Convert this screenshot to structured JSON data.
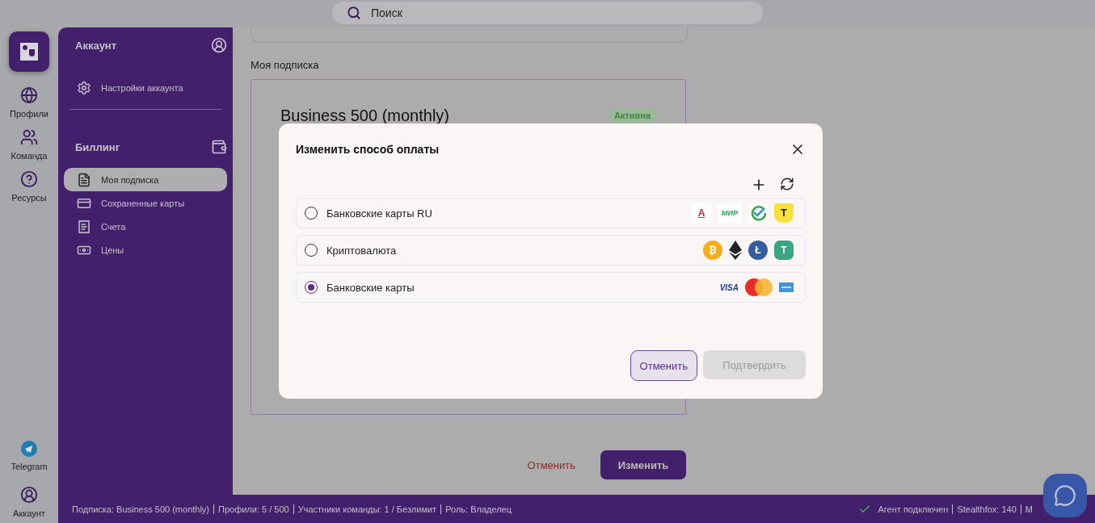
{
  "search": {
    "placeholder": "Поиск"
  },
  "rail": {
    "top": [
      {
        "kind": "globe",
        "label": "Профили"
      },
      {
        "kind": "team",
        "label": "Команда"
      },
      {
        "kind": "help",
        "label": "Ресурсы"
      }
    ],
    "bottom": [
      {
        "kind": "telegram",
        "label": "Telegram"
      },
      {
        "kind": "account",
        "label": "Аккаунт"
      }
    ]
  },
  "sidebar": {
    "sections": [
      {
        "kind": "account",
        "title": "Аккаунт",
        "items": [
          {
            "kind": "settings",
            "label": "Настройки аккаунта",
            "selected": false
          }
        ]
      },
      {
        "kind": "billing",
        "title": "Биллинг",
        "items": [
          {
            "kind": "document",
            "label": "Моя подписка",
            "selected": true
          },
          {
            "kind": "card",
            "label": "Сохраненные карты",
            "selected": false
          },
          {
            "kind": "invoice",
            "label": "Счета",
            "selected": false
          },
          {
            "kind": "money",
            "label": "Цены",
            "selected": false
          }
        ]
      }
    ]
  },
  "content": {
    "section_title": "Моя подписка",
    "plan": {
      "name": "Business 500 (monthly)",
      "status": "Активна"
    },
    "buttons": {
      "cancel": "Отменить",
      "change": "Изменить"
    }
  },
  "dialog": {
    "title": "Изменить способ оплаты",
    "options": [
      {
        "label": "Банковские карты RU",
        "selected": false,
        "logos": [
          {
            "kind": "alfa",
            "text": "А"
          },
          {
            "kind": "mir",
            "text": "МИР"
          },
          {
            "kind": "sber"
          },
          {
            "kind": "tbank",
            "text": "Т"
          }
        ]
      },
      {
        "label": "Криптовалюта",
        "selected": false,
        "logos": [
          {
            "kind": "bitcoin",
            "text": "₿"
          },
          {
            "kind": "ethereum"
          },
          {
            "kind": "litecoin",
            "text": "Ł"
          },
          {
            "kind": "tether",
            "text": "T"
          }
        ]
      },
      {
        "label": "Банковские карты",
        "selected": true,
        "logos": [
          {
            "kind": "visa",
            "text": "VISA"
          },
          {
            "kind": "mastercard"
          },
          {
            "kind": "amex"
          }
        ]
      }
    ],
    "buttons": {
      "cancel": "Отменить",
      "confirm": "Подтвердить",
      "confirm_disabled": true
    }
  },
  "status_bar": {
    "left": [
      "Подписка: Business 500 (monthly)",
      "Профили: 5 / 500",
      "Участники команды: 1 / Безлимит",
      "Роль: Владелец"
    ],
    "right": [
      "Агент подключен",
      "Stealthfox: 140",
      "M"
    ]
  }
}
